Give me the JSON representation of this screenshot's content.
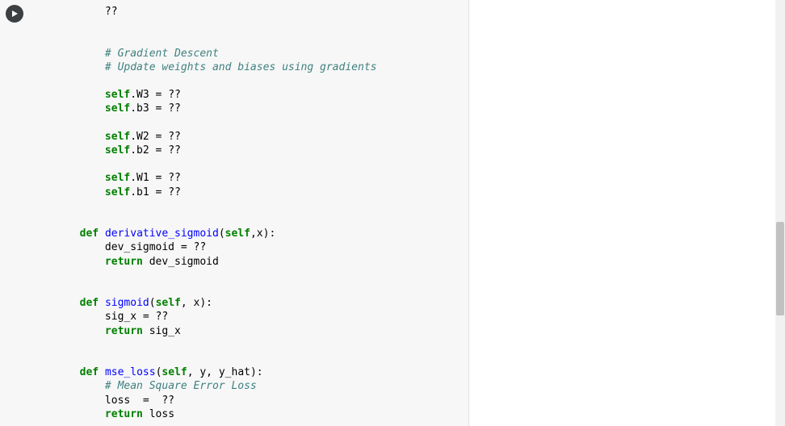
{
  "editor": {
    "run_button_title": "Run cell",
    "lines": [
      {
        "indent": 8,
        "tokens": [
          {
            "t": "??",
            "c": ""
          }
        ]
      },
      {
        "indent": 0,
        "tokens": []
      },
      {
        "indent": 0,
        "tokens": []
      },
      {
        "indent": 8,
        "tokens": [
          {
            "t": "# Gradient Descent",
            "c": "cm"
          }
        ]
      },
      {
        "indent": 8,
        "tokens": [
          {
            "t": "# Update weights and biases using gradients",
            "c": "cm"
          }
        ]
      },
      {
        "indent": 0,
        "tokens": []
      },
      {
        "indent": 8,
        "tokens": [
          {
            "t": "self",
            "c": "sf"
          },
          {
            "t": ".W3 = ??",
            "c": ""
          }
        ]
      },
      {
        "indent": 8,
        "tokens": [
          {
            "t": "self",
            "c": "sf"
          },
          {
            "t": ".b3 = ??",
            "c": ""
          }
        ]
      },
      {
        "indent": 0,
        "tokens": []
      },
      {
        "indent": 8,
        "tokens": [
          {
            "t": "self",
            "c": "sf"
          },
          {
            "t": ".W2 = ??",
            "c": ""
          }
        ]
      },
      {
        "indent": 8,
        "tokens": [
          {
            "t": "self",
            "c": "sf"
          },
          {
            "t": ".b2 = ??",
            "c": ""
          }
        ]
      },
      {
        "indent": 0,
        "tokens": []
      },
      {
        "indent": 8,
        "tokens": [
          {
            "t": "self",
            "c": "sf"
          },
          {
            "t": ".W1 = ??",
            "c": ""
          }
        ]
      },
      {
        "indent": 8,
        "tokens": [
          {
            "t": "self",
            "c": "sf"
          },
          {
            "t": ".b1 = ??",
            "c": ""
          }
        ]
      },
      {
        "indent": 0,
        "tokens": []
      },
      {
        "indent": 0,
        "tokens": []
      },
      {
        "indent": 4,
        "tokens": [
          {
            "t": "def",
            "c": "kw"
          },
          {
            "t": " ",
            "c": ""
          },
          {
            "t": "derivative_sigmoid",
            "c": "fn"
          },
          {
            "t": "(",
            "c": ""
          },
          {
            "t": "self",
            "c": "sf"
          },
          {
            "t": ",x):",
            "c": ""
          }
        ]
      },
      {
        "indent": 8,
        "tokens": [
          {
            "t": "dev_sigmoid = ??",
            "c": ""
          }
        ]
      },
      {
        "indent": 8,
        "tokens": [
          {
            "t": "return",
            "c": "kw"
          },
          {
            "t": " dev_sigmoid",
            "c": ""
          }
        ]
      },
      {
        "indent": 0,
        "tokens": []
      },
      {
        "indent": 0,
        "tokens": []
      },
      {
        "indent": 4,
        "tokens": [
          {
            "t": "def",
            "c": "kw"
          },
          {
            "t": " ",
            "c": ""
          },
          {
            "t": "sigmoid",
            "c": "fn"
          },
          {
            "t": "(",
            "c": ""
          },
          {
            "t": "self",
            "c": "sf"
          },
          {
            "t": ", x):",
            "c": ""
          }
        ]
      },
      {
        "indent": 8,
        "tokens": [
          {
            "t": "sig_x = ??",
            "c": ""
          }
        ]
      },
      {
        "indent": 8,
        "tokens": [
          {
            "t": "return",
            "c": "kw"
          },
          {
            "t": " sig_x",
            "c": ""
          }
        ]
      },
      {
        "indent": 0,
        "tokens": []
      },
      {
        "indent": 0,
        "tokens": []
      },
      {
        "indent": 4,
        "tokens": [
          {
            "t": "def",
            "c": "kw"
          },
          {
            "t": " ",
            "c": ""
          },
          {
            "t": "mse_loss",
            "c": "fn"
          },
          {
            "t": "(",
            "c": ""
          },
          {
            "t": "self",
            "c": "sf"
          },
          {
            "t": ", y, y_hat):",
            "c": ""
          }
        ]
      },
      {
        "indent": 8,
        "tokens": [
          {
            "t": "# Mean Square Error Loss",
            "c": "cm"
          }
        ]
      },
      {
        "indent": 8,
        "tokens": [
          {
            "t": "loss  =  ??",
            "c": ""
          }
        ]
      },
      {
        "indent": 8,
        "tokens": [
          {
            "t": "return",
            "c": "kw"
          },
          {
            "t": " loss",
            "c": ""
          }
        ]
      }
    ]
  },
  "scrollbar": {
    "thumb_top_pct": 52,
    "thumb_height_pct": 22
  }
}
